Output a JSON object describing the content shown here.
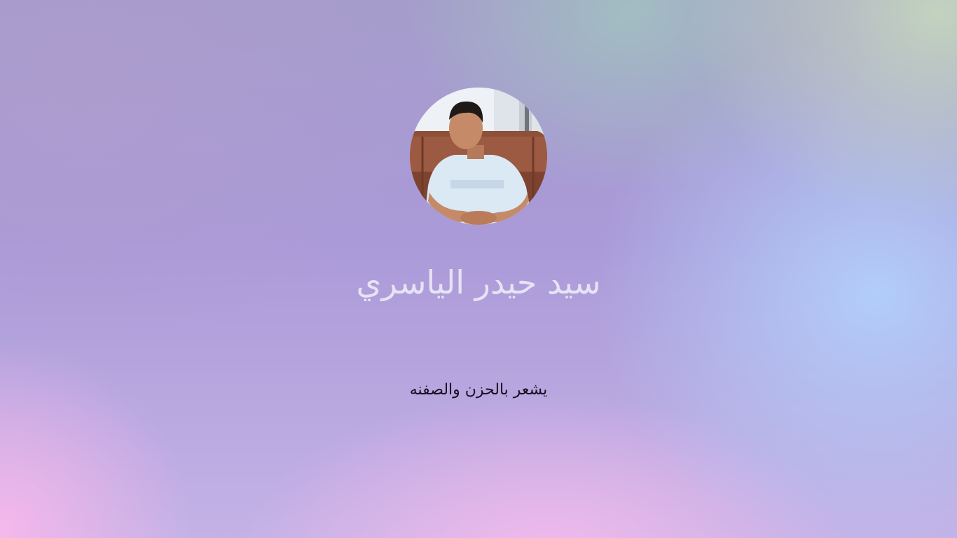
{
  "profile": {
    "name": "سيد حيدر الياسري",
    "bio": "يشعر بالحزن والصفنه",
    "avatar_icon": "profile-photo"
  },
  "colors": {
    "name_text": "#e7e3f4",
    "bio_text": "#1a1020"
  }
}
